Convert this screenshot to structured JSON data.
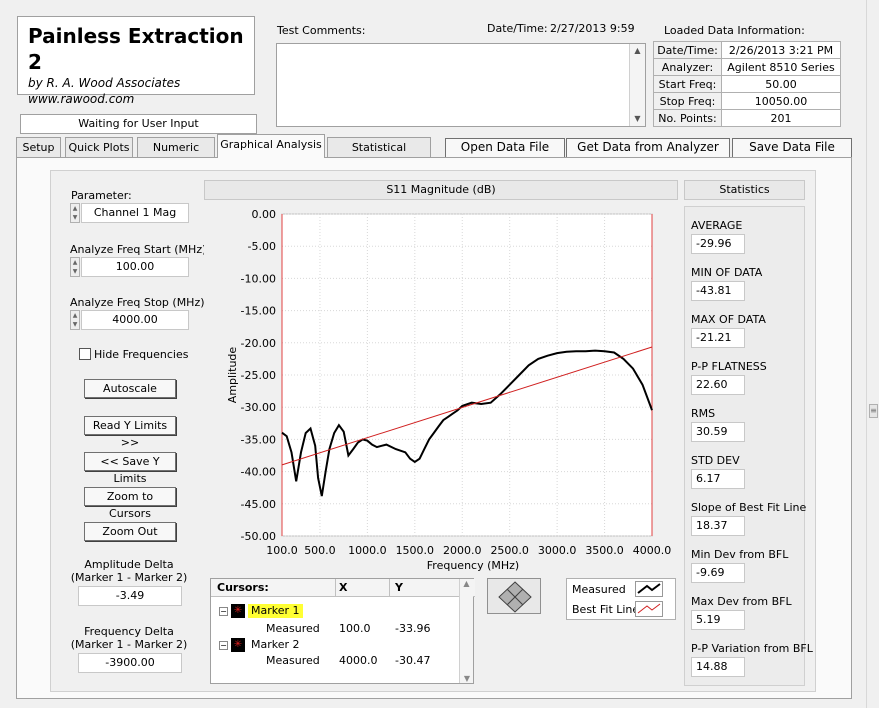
{
  "app": {
    "title": "Painless Extraction 2",
    "byline": "by R. A. Wood Associates",
    "website": "www.rawood.com",
    "status": "Waiting for User Input"
  },
  "header": {
    "comments_label": "Test Comments:",
    "datetime_label": "Date/Time:",
    "datetime_value": "2/27/2013  9:59",
    "loaded_label": "Loaded Data Information:",
    "loaded": [
      {
        "k": "Date/Time:",
        "v": "2/26/2013 3:21 PM"
      },
      {
        "k": "Analyzer:",
        "v": "Agilent 8510 Series"
      },
      {
        "k": "Start Freq:",
        "v": "50.00"
      },
      {
        "k": "Stop Freq:",
        "v": "10050.00"
      },
      {
        "k": "No. Points:",
        "v": "201"
      }
    ]
  },
  "tabs": [
    "Setup",
    "Quick Plots",
    "Numeric Data",
    "Graphical Analysis",
    "Statistical Analysis"
  ],
  "actions": {
    "open": "Open Data File",
    "get": "Get Data from Analyzer",
    "save": "Save Data File"
  },
  "left": {
    "parameter_label": "Parameter:",
    "parameter_value": "Channel 1 Mag",
    "start_label": "Analyze Freq Start (MHz)",
    "start_value": "100.00",
    "stop_label": "Analyze Freq Stop (MHz)",
    "stop_value": "4000.00",
    "hide_label": "Hide Frequencies",
    "autoscale": "Autoscale",
    "read_y": "Read Y Limits >>",
    "save_y": "<< Save Y Limits",
    "zoom_cursors": "Zoom to Cursors",
    "zoom_out": "Zoom Out",
    "amp_delta_label1": "Amplitude Delta",
    "amp_delta_label2": "(Marker 1 - Marker 2)",
    "amp_delta_value": "-3.49",
    "freq_delta_label1": "Frequency Delta",
    "freq_delta_label2": "(Marker 1 - Marker 2)",
    "freq_delta_value": "-3900.00"
  },
  "chart_data": {
    "type": "line",
    "title": "S11 Magnitude (dB)",
    "xlabel": "Frequency (MHz)",
    "ylabel": "Amplitude",
    "xlim": [
      100,
      4000
    ],
    "ylim": [
      -50,
      0
    ],
    "xticks": [
      "100.0",
      "500.0",
      "1000.0",
      "1500.0",
      "2000.0",
      "2500.0",
      "3000.0",
      "3500.0",
      "4000.0"
    ],
    "yticks": [
      "0.00",
      "-5.00",
      "-10.00",
      "-15.00",
      "-20.00",
      "-25.00",
      "-30.00",
      "-35.00",
      "-40.00",
      "-45.00",
      "-50.00"
    ],
    "series": [
      {
        "name": "Measured",
        "color": "#000000",
        "x": [
          100,
          150,
          200,
          250,
          300,
          350,
          400,
          450,
          480,
          520,
          560,
          600,
          650,
          700,
          750,
          800,
          850,
          900,
          950,
          1000,
          1050,
          1100,
          1150,
          1200,
          1300,
          1400,
          1450,
          1500,
          1550,
          1600,
          1650,
          1700,
          1750,
          1800,
          1850,
          1900,
          1950,
          2000,
          2100,
          2200,
          2300,
          2400,
          2500,
          2600,
          2700,
          2800,
          2900,
          3000,
          3100,
          3200,
          3300,
          3400,
          3500,
          3600,
          3700,
          3800,
          3900,
          3950,
          4000
        ],
        "y": [
          -33.96,
          -34.5,
          -37,
          -41.5,
          -37,
          -34,
          -33.3,
          -36,
          -41,
          -43.8,
          -40,
          -36.5,
          -34,
          -32.8,
          -33.8,
          -37.5,
          -36.5,
          -35.5,
          -35,
          -35.2,
          -35.8,
          -36.2,
          -36,
          -35.8,
          -36.5,
          -37,
          -38,
          -38.5,
          -38,
          -36.5,
          -35,
          -34,
          -33,
          -32,
          -31.5,
          -31,
          -30.5,
          -29.8,
          -29.3,
          -29.5,
          -29.3,
          -28,
          -26.5,
          -25,
          -23.5,
          -22.5,
          -22,
          -21.6,
          -21.4,
          -21.3,
          -21.3,
          -21.21,
          -21.3,
          -21.5,
          -22.5,
          -24,
          -26.5,
          -28.5,
          -30.47
        ]
      },
      {
        "name": "Best Fit Line",
        "color": "#d02020",
        "x": [
          100,
          4000
        ],
        "y": [
          -38.96,
          -20.65
        ]
      }
    ],
    "legend_position": "bottom-right"
  },
  "cursors": {
    "title": "Cursors:",
    "col_x": "X",
    "col_y": "Y",
    "rows": [
      {
        "name": "Marker 1",
        "sub": "Measured",
        "x": "100.0",
        "y": "-33.96"
      },
      {
        "name": "Marker 2",
        "sub": "Measured",
        "x": "4000.0",
        "y": "-30.47"
      }
    ]
  },
  "legend": [
    "Measured",
    "Best Fit Line"
  ],
  "stats": {
    "title": "Statistics",
    "items": [
      {
        "k": "AVERAGE",
        "v": "-29.96"
      },
      {
        "k": "MIN OF DATA",
        "v": "-43.81"
      },
      {
        "k": "MAX OF DATA",
        "v": "-21.21"
      },
      {
        "k": "P-P FLATNESS",
        "v": "22.60"
      },
      {
        "k": "RMS",
        "v": "30.59"
      },
      {
        "k": "STD DEV",
        "v": "6.17"
      },
      {
        "k": "Slope of Best Fit Line",
        "v": "18.37"
      },
      {
        "k": "Min Dev from BFL",
        "v": "-9.69"
      },
      {
        "k": "Max Dev from BFL",
        "v": "5.19"
      },
      {
        "k": "P-P Variation from BFL",
        "v": "14.88"
      }
    ]
  }
}
